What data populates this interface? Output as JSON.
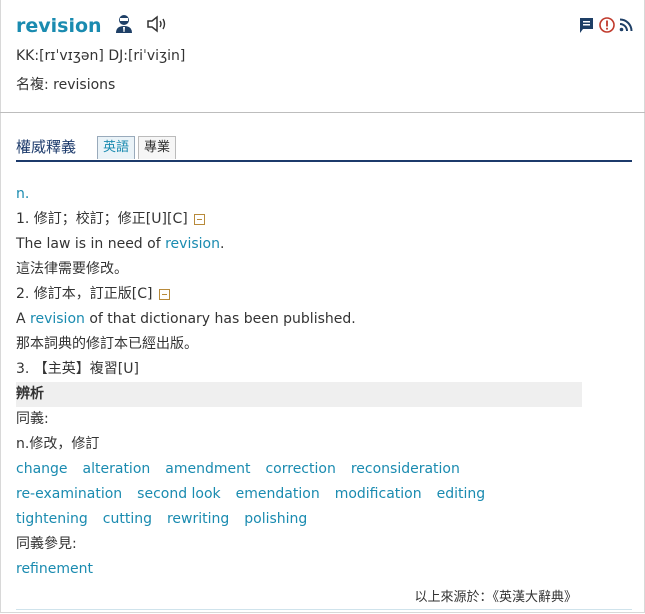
{
  "entry": {
    "word": "revision",
    "pronunciation": "KK:[rɪˈvɪʒən] DJ:[riˈviʒin]",
    "plural": "名複: revisions"
  },
  "icons": {
    "person": "person-icon",
    "speaker": "speaker-icon",
    "bookmark": "bookmark-icon",
    "report": "alert-icon",
    "rss": "rss-icon"
  },
  "tabs": {
    "title": "權威釋義",
    "items": [
      {
        "label": "英語",
        "active": true
      },
      {
        "label": "專業",
        "active": false
      }
    ]
  },
  "definitions": {
    "pos": "n.",
    "senses": [
      {
        "label": "1. 修訂；校訂；修正[U][C]",
        "ex_en_pre": "The law is in need of ",
        "ex_en_word": "revision",
        "ex_en_post": ".",
        "ex_zh": "這法律需要修改。"
      },
      {
        "label": "2. 修訂本，訂正版[C]",
        "ex_en_pre": "A ",
        "ex_en_word": "revision",
        "ex_en_post": " of that dictionary has been published.",
        "ex_zh": "那本詞典的修訂本已經出版。"
      },
      {
        "label": "3. 【主英】複習[U]"
      }
    ]
  },
  "analysis": {
    "heading": "辨析",
    "synonyms_label": "同義:",
    "synonyms_pos": "n.修改，修訂",
    "synonyms": [
      "change",
      "alteration",
      "amendment",
      "correction",
      "reconsideration",
      "re-examination",
      "second look",
      "emendation",
      "modification",
      "editing",
      "tightening",
      "cutting",
      "rewriting",
      "polishing"
    ],
    "see_also_label": "同義參見:",
    "see_also": [
      "refinement"
    ]
  },
  "source": "以上來源於：《英漢大辭典》",
  "colors": {
    "link": "#1a8bb0",
    "tab_border": "#1c3a6b"
  }
}
